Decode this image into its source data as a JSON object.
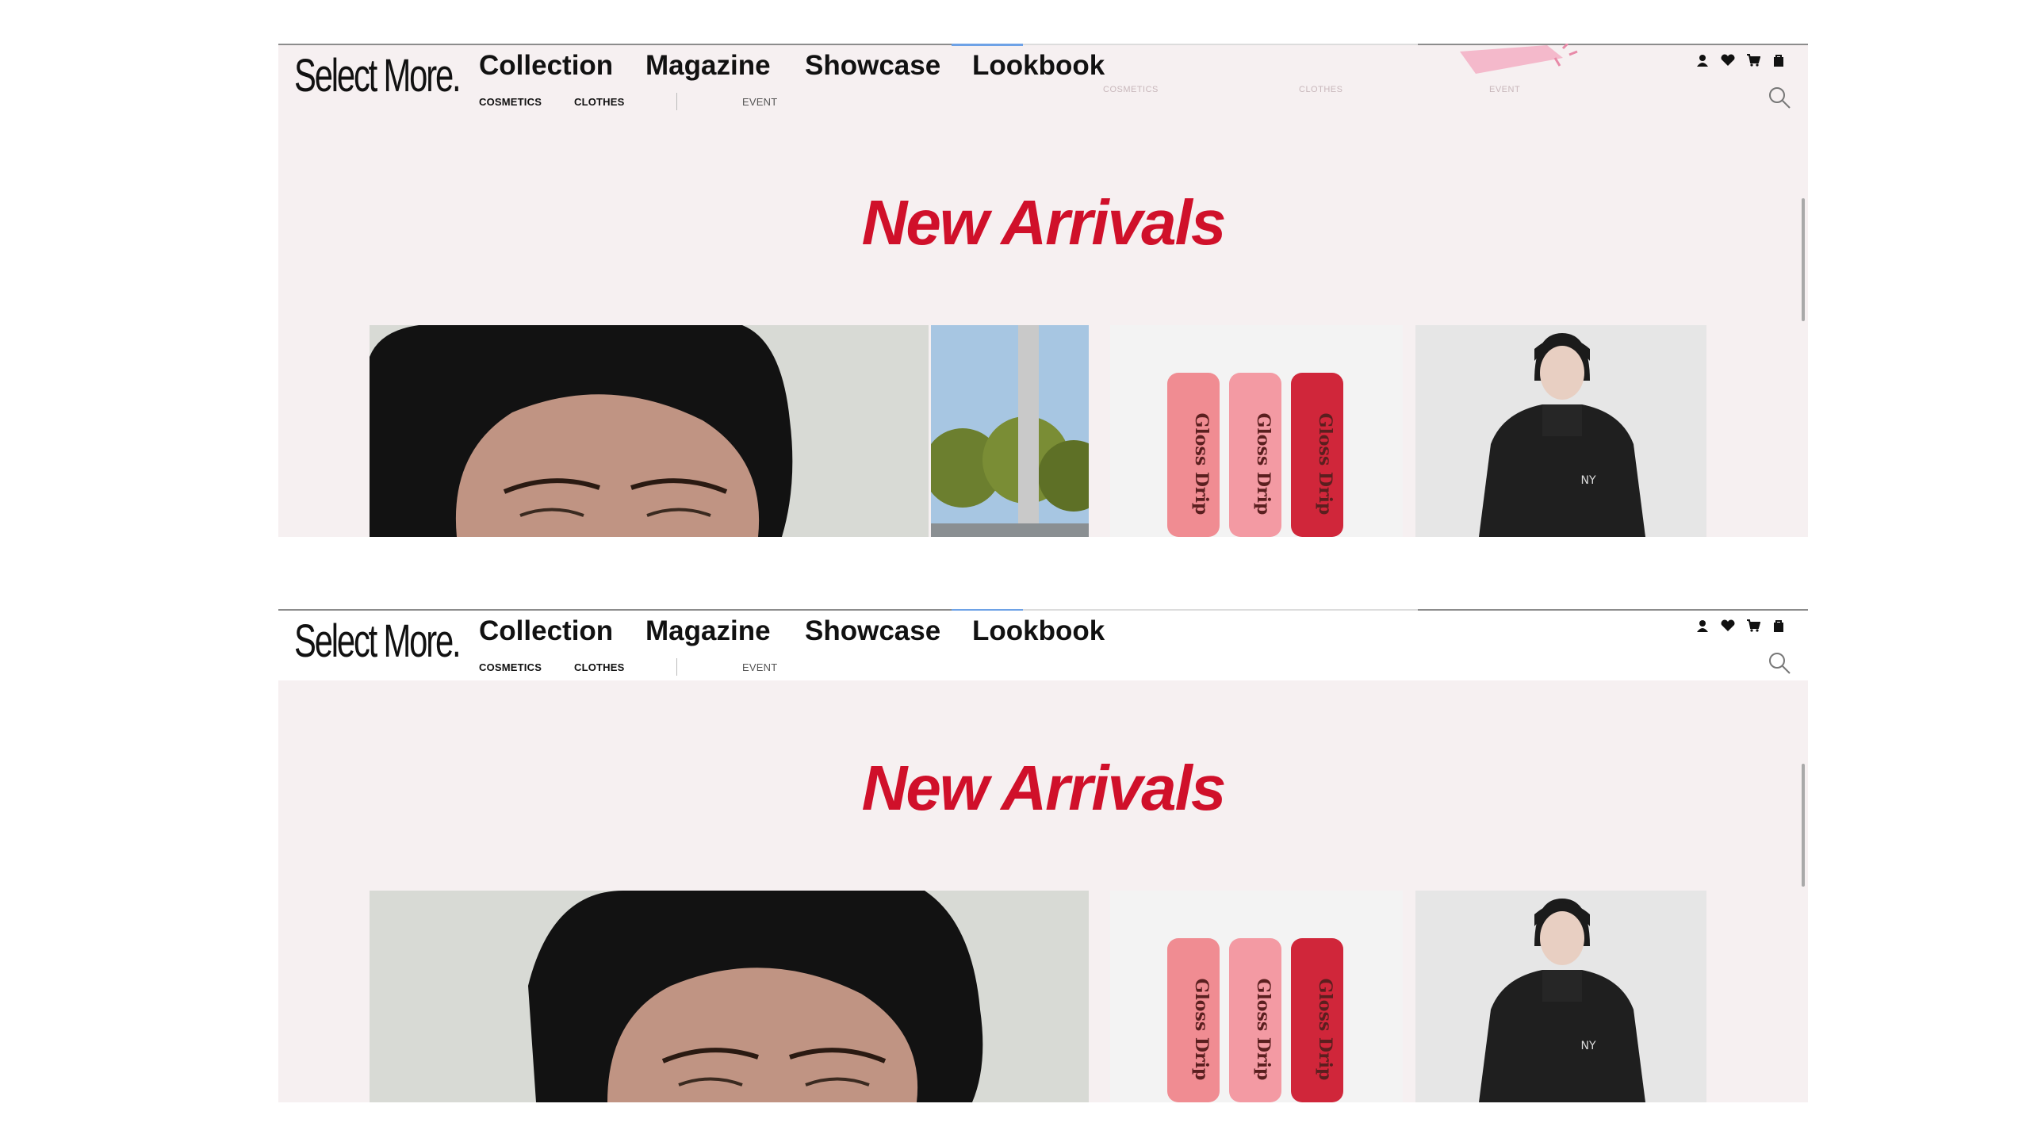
{
  "header": {
    "logo": "Select More.",
    "nav": [
      "Collection",
      "Magazine",
      "Showcase",
      "Lookbook"
    ],
    "subnav": [
      "COSMETICS",
      "CLOTHES",
      "EVENT"
    ],
    "ghost_subnav": [
      "COSMETICS",
      "CLOTHES",
      "EVENT"
    ],
    "icons": [
      "user-icon",
      "heart-icon",
      "cart-icon",
      "bag-icon",
      "search-icon"
    ]
  },
  "main": {
    "title": "New Arrivals",
    "products": [
      {
        "name": "portrait-photo",
        "icon": "model-portrait"
      },
      {
        "name": "outdoor-scene",
        "icon": "trees-and-pole"
      },
      {
        "name": "gloss-drip",
        "label": "Gloss Drip"
      },
      {
        "name": "puffer-jacket",
        "label": "NY"
      }
    ]
  },
  "colors": {
    "accent": "#d0102a",
    "background": "#f6f0f1",
    "text": "#111111"
  }
}
